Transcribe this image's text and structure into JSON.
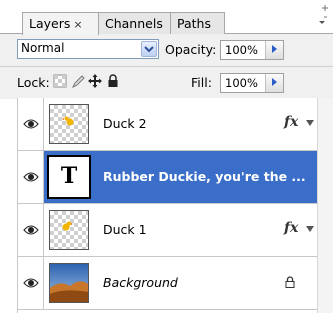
{
  "tabs": [
    {
      "label": "Layers",
      "close": "×"
    },
    {
      "label": "Channels"
    },
    {
      "label": "Paths"
    }
  ],
  "blend": {
    "mode": "Normal",
    "opacity_label": "Opacity:",
    "opacity_value": "100%"
  },
  "lock": {
    "label": "Lock:",
    "fill_label": "Fill:",
    "fill_value": "100%"
  },
  "layers": [
    {
      "name": "Duck 2",
      "fx": "fx",
      "selected": false
    },
    {
      "name": "Rubber Duckie, you're the ...",
      "thumb_letter": "T",
      "selected": true
    },
    {
      "name": "Duck 1",
      "fx": "fx",
      "selected": false
    },
    {
      "name": "Background",
      "locked": true,
      "selected": false
    }
  ],
  "colors": {
    "selection": "#3a6ec9"
  }
}
